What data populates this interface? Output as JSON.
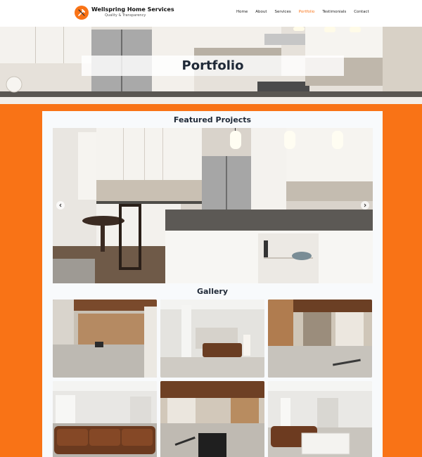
{
  "header": {
    "brand_name": "Wellspring Home Services",
    "brand_tagline": "Quality & Transparency",
    "logo_icon": "wrench-hammer-icon",
    "nav": [
      {
        "label": "Home",
        "active": false
      },
      {
        "label": "About",
        "active": false
      },
      {
        "label": "Services",
        "active": false
      },
      {
        "label": "Portfolio",
        "active": true
      },
      {
        "label": "Testimonials",
        "active": false
      },
      {
        "label": "Contact",
        "active": false
      }
    ]
  },
  "hero": {
    "title": "Portfolio"
  },
  "featured": {
    "title": "Featured Projects",
    "prev_icon": "chevron-left-icon",
    "next_icon": "chevron-right-icon"
  },
  "gallery": {
    "title": "Gallery"
  },
  "colors": {
    "accent": "#f97316",
    "heading": "#1f2937",
    "card": "#f8fafc"
  }
}
